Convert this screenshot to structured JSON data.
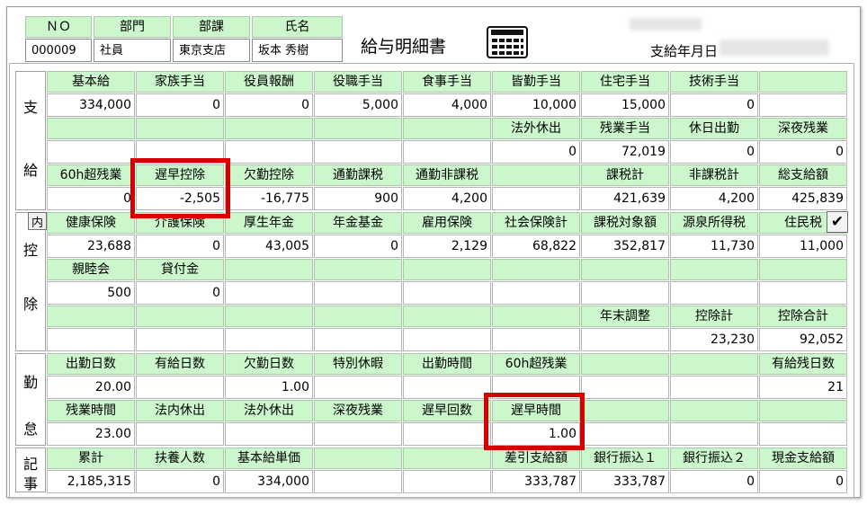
{
  "header": {
    "labels": [
      "ＮＯ",
      "部門",
      "部課",
      "氏名"
    ],
    "values": [
      "000009",
      "社員",
      "東京支店",
      "坂本 秀樹"
    ],
    "title": "給与明細書",
    "calc_icon": "calculator-icon",
    "pay_date_label": "支給年月日"
  },
  "sections": {
    "shikyu": [
      "支",
      "給"
    ],
    "koujo": [
      "控",
      "除"
    ],
    "kintai": [
      "勤",
      "怠"
    ],
    "kiji": [
      "記",
      "事"
    ],
    "naiyo_button": "内",
    "check_icon": "✔"
  },
  "rows": {
    "r1_labels": [
      "基本給",
      "家族手当",
      "役員報酬",
      "役職手当",
      "食事手当",
      "皆勤手当",
      "住宅手当",
      "技術手当",
      ""
    ],
    "r1_values": [
      "334,000",
      "0",
      "0",
      "5,000",
      "4,000",
      "10,000",
      "15,000",
      "0",
      ""
    ],
    "r2_labels": [
      "",
      "",
      "",
      "",
      "",
      "法外休出",
      "残業手当",
      "休日出勤",
      "深夜残業"
    ],
    "r2_values": [
      "",
      "",
      "",
      "",
      "",
      "0",
      "72,019",
      "0",
      "0"
    ],
    "r3_labels": [
      "60h超残業",
      "遅早控除",
      "欠勤控除",
      "通勤課税",
      "通勤非課税",
      "",
      "課税計",
      "非課税計",
      "総支給額"
    ],
    "r3_values": [
      "0",
      "-2,505",
      "-16,775",
      "900",
      "4,200",
      "",
      "421,639",
      "4,200",
      "425,839"
    ],
    "r4_labels": [
      "健康保険",
      "介護保険",
      "厚生年金",
      "年金基金",
      "雇用保険",
      "社会保険計",
      "課税対象額",
      "源泉所得税",
      "住民税"
    ],
    "r4_values": [
      "23,688",
      "0",
      "43,005",
      "0",
      "2,129",
      "68,822",
      "352,817",
      "11,730",
      "11,000"
    ],
    "r5_labels": [
      "親睦会",
      "貸付金",
      "",
      "",
      "",
      "",
      "",
      "",
      ""
    ],
    "r5_values": [
      "500",
      "0",
      "",
      "",
      "",
      "",
      "",
      "",
      ""
    ],
    "r6_labels": [
      "",
      "",
      "",
      "",
      "",
      "",
      "年末調整",
      "控除計",
      "控除合計"
    ],
    "r6_values": [
      "",
      "",
      "",
      "",
      "",
      "",
      "",
      "23,230",
      "92,052"
    ],
    "r7_labels": [
      "出勤日数",
      "有給日数",
      "欠勤日数",
      "特別休暇",
      "出勤時間",
      "60h超残業",
      "",
      "",
      "有給残日数"
    ],
    "r7_values": [
      "20.00",
      "",
      "1.00",
      "",
      "",
      "",
      "",
      "",
      "21"
    ],
    "r8_labels": [
      "残業時間",
      "法内休出",
      "法外休出",
      "深夜残業",
      "遅早回数",
      "遅早時間",
      "",
      "",
      ""
    ],
    "r8_values": [
      "23.00",
      "",
      "",
      "",
      "",
      "1.00",
      "",
      "",
      ""
    ],
    "r9_labels": [
      "累計",
      "扶養人数",
      "基本給単価",
      "",
      "",
      "差引支給額",
      "銀行振込１",
      "銀行振込２",
      "現金支給額"
    ],
    "r9_values": [
      "2,185,315",
      "0",
      "334,000",
      "",
      "",
      "333,787",
      "333,787",
      "0",
      "0"
    ]
  }
}
